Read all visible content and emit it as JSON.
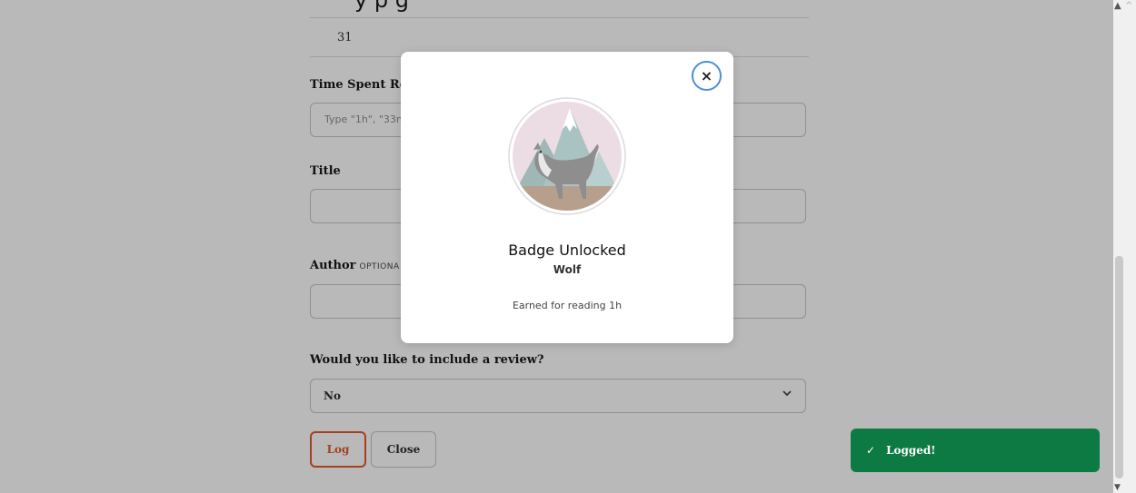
{
  "page": {
    "top_heading_fragment": "y                         p    g",
    "pages_value": "31",
    "time_label": "Time Spent Re",
    "time_placeholder": "Type \"1h\", \"33n",
    "title_label": "Title",
    "author_label": "Author",
    "author_optional": "OPTIONA",
    "review_label": "Would you like to include a review?",
    "review_selected": "No",
    "log_button": "Log",
    "close_button": "Close"
  },
  "modal": {
    "close_glyph": "×",
    "title": "Badge Unlocked",
    "badge_name": "Wolf",
    "description": "Earned for reading 1h"
  },
  "toast": {
    "check": "✓",
    "message": "Logged!"
  },
  "colors": {
    "overlay": "#b9b9b9",
    "log_accent": "#a3401f",
    "toast_bg": "#0e7a43",
    "close_ring": "#4a8fd9"
  }
}
